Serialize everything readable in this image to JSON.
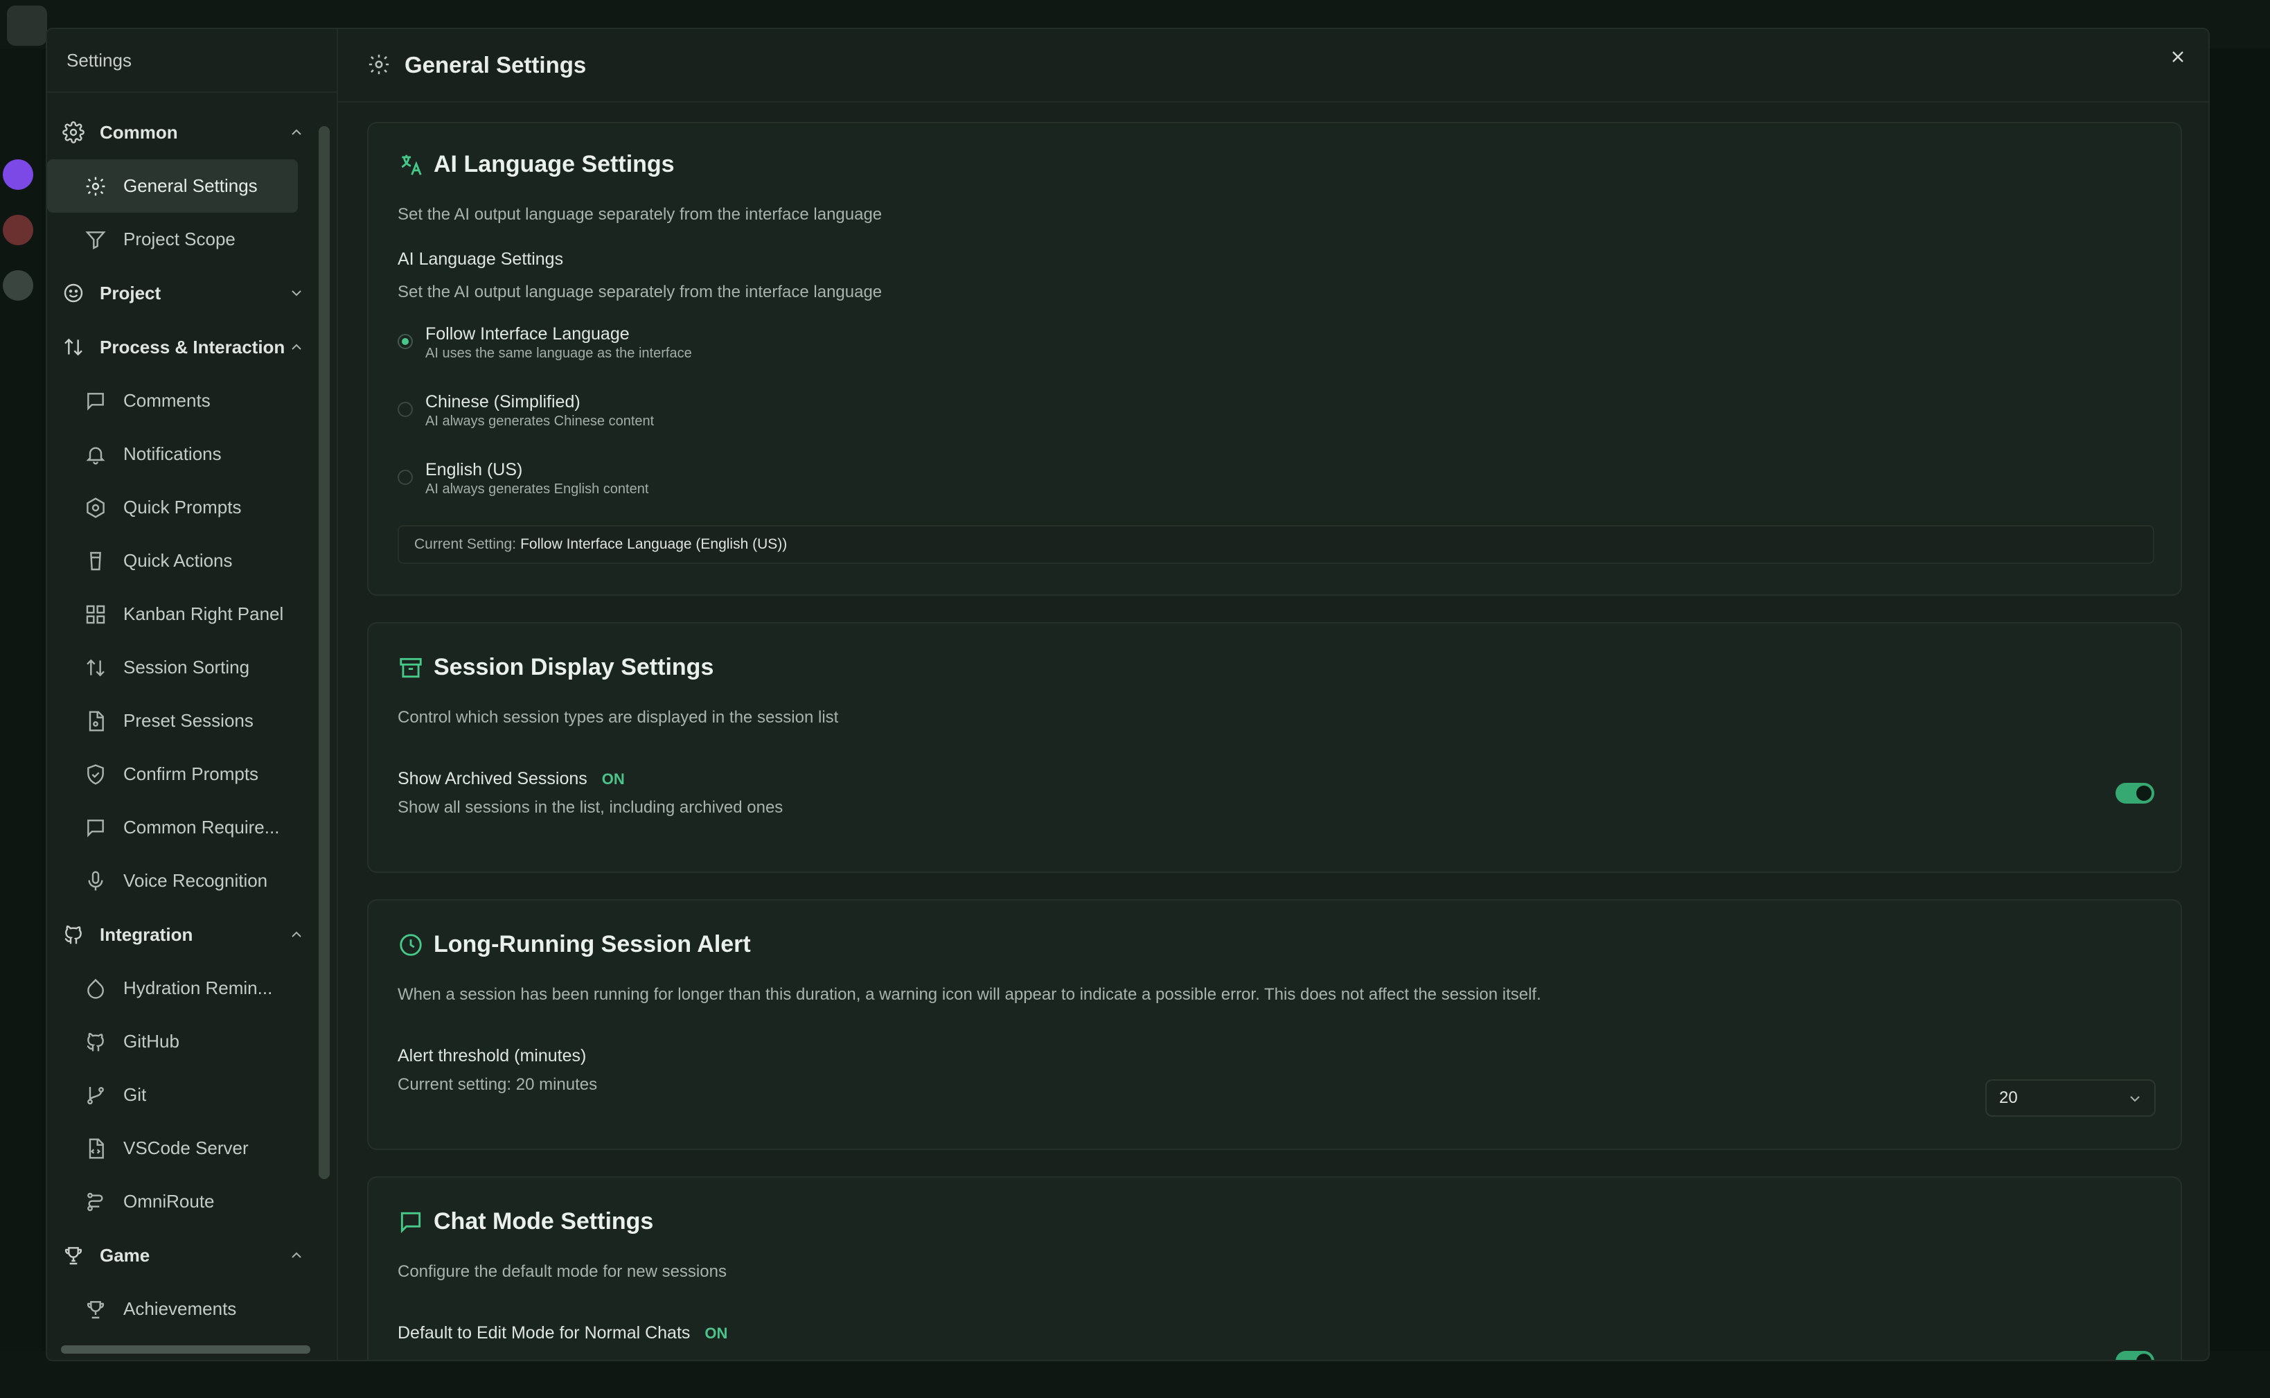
{
  "sidebar": {
    "title": "Settings",
    "groups": [
      {
        "label": "Common",
        "icon": "gear-icon",
        "expanded": true,
        "items": [
          {
            "label": "General Settings",
            "icon": "gear-icon",
            "active": true
          },
          {
            "label": "Project Scope",
            "icon": "filter-icon"
          }
        ]
      },
      {
        "label": "Project",
        "icon": "smile-icon",
        "expanded": false,
        "items": []
      },
      {
        "label": "Process & Interaction",
        "icon": "sort-icon",
        "expanded": true,
        "items": [
          {
            "label": "Comments",
            "icon": "comment-icon"
          },
          {
            "label": "Notifications",
            "icon": "bell-icon"
          },
          {
            "label": "Quick Prompts",
            "icon": "hexagon-icon"
          },
          {
            "label": "Quick Actions",
            "icon": "cup-icon"
          },
          {
            "label": "Kanban Right Panel",
            "icon": "grid-icon"
          },
          {
            "label": "Session Sorting",
            "icon": "sort-icon"
          },
          {
            "label": "Preset Sessions",
            "icon": "file-icon"
          },
          {
            "label": "Confirm Prompts",
            "icon": "shield-check-icon"
          },
          {
            "label": "Common Require...",
            "icon": "comment-icon"
          },
          {
            "label": "Voice Recognition",
            "icon": "mic-icon"
          }
        ]
      },
      {
        "label": "Integration",
        "icon": "github-icon",
        "expanded": true,
        "items": [
          {
            "label": "Hydration Remin...",
            "icon": "droplet-icon"
          },
          {
            "label": "GitHub",
            "icon": "github-icon"
          },
          {
            "label": "Git",
            "icon": "git-branch-icon"
          },
          {
            "label": "VSCode Server",
            "icon": "code-file-icon"
          },
          {
            "label": "OmniRoute",
            "icon": "route-icon"
          }
        ]
      },
      {
        "label": "Game",
        "icon": "trophy-icon",
        "expanded": true,
        "items": [
          {
            "label": "Achievements",
            "icon": "trophy-icon"
          }
        ]
      }
    ]
  },
  "header": {
    "title": "General Settings",
    "icon": "gear-icon",
    "close_icon": "close-icon"
  },
  "ai_language": {
    "title": "AI Language Settings",
    "description": "Set the AI output language separately from the interface language",
    "sub_label": "AI Language Settings",
    "sub_description": "Set the AI output language separately from the interface language",
    "options": [
      {
        "title": "Follow Interface Language",
        "sub": "AI uses the same language as the interface",
        "checked": true
      },
      {
        "title": "Chinese (Simplified)",
        "sub": "AI always generates Chinese content",
        "checked": false
      },
      {
        "title": "English (US)",
        "sub": "AI always generates English content",
        "checked": false
      }
    ],
    "current_prefix": "Current Setting:",
    "current_value": "Follow Interface Language (English (US))"
  },
  "session_display": {
    "title": "Session Display Settings",
    "description": "Control which session types are displayed in the session list",
    "label": "Show Archived Sessions",
    "badge": "ON",
    "sub": "Show all sessions in the list, including archived ones",
    "enabled": true
  },
  "long_running": {
    "title": "Long-Running Session Alert",
    "description": "When a session has been running for longer than this duration, a warning icon will appear to indicate a possible error. This does not affect the session itself.",
    "label": "Alert threshold (minutes)",
    "sub": "Current setting: 20 minutes",
    "value": "20"
  },
  "chat_mode": {
    "title": "Chat Mode Settings",
    "description": "Configure the default mode for new sessions",
    "label": "Default to Edit Mode for Normal Chats",
    "badge": "ON",
    "enabled": true
  },
  "colors": {
    "accent": "#47c98a",
    "background": "#18211c",
    "card": "#1b2520"
  }
}
